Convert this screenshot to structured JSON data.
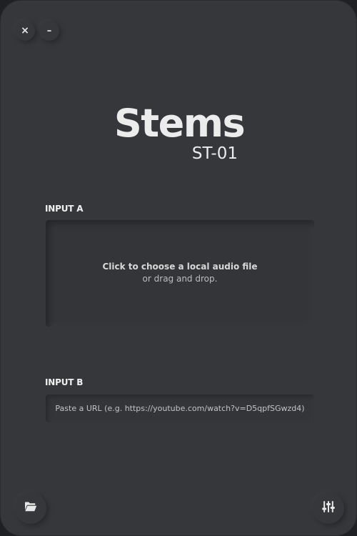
{
  "window_controls": {
    "close_glyph": "×",
    "minimize_glyph": "–"
  },
  "header": {
    "title": "Stems",
    "subtitle": "ST-01"
  },
  "input_a": {
    "label": "INPUT A",
    "dropzone_primary": "Click to choose a local audio file",
    "dropzone_secondary": "or drag and drop."
  },
  "input_b": {
    "label": "INPUT B",
    "placeholder": "Paste a URL (e.g. https://youtube.com/watch?v=D5qpfSGwzd4)",
    "value": ""
  },
  "footer": {
    "left_icon": "folder-open-icon",
    "right_icon": "mixer-sliders-icon"
  },
  "colors": {
    "window_bg": "#35373b",
    "text_primary": "#ececec",
    "text_secondary": "#bdbdbd"
  }
}
